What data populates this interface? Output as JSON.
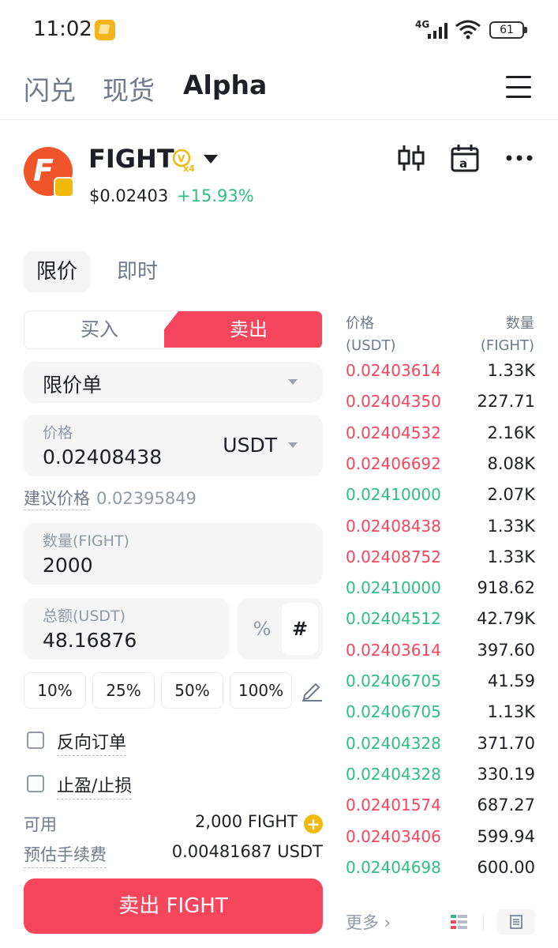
{
  "status_bar": {
    "time": "11:02",
    "network": "4G",
    "battery": "61"
  },
  "nav": {
    "tabs": [
      "闪兑",
      "现货",
      "Alpha"
    ],
    "active": "Alpha"
  },
  "token": {
    "name": "FIGHT",
    "badge": "x4",
    "price": "$0.02403",
    "change": "+15.93%",
    "change_color": "#2ebd85"
  },
  "order_tabs": [
    "限价",
    "即时"
  ],
  "side": {
    "buy": "买入",
    "sell": "卖出",
    "sell_color": "#f6465d"
  },
  "form": {
    "order_type": "限价单",
    "price_label": "价格",
    "price_value": "0.02408438",
    "price_unit": "USDT",
    "suggest_label": "建议价格",
    "suggest_value": "0.02395849",
    "qty_label": "数量(FIGHT)",
    "qty_value": "2000",
    "total_label": "总额(USDT)",
    "total_value": "48.16876",
    "mode_pct": "%",
    "mode_hash": "#",
    "pct_buttons": [
      "10%",
      "25%",
      "50%",
      "100%"
    ],
    "reverse_order": "反向订单",
    "tp_sl": "止盈/止损",
    "available_label": "可用",
    "available_value": "2,000 FIGHT",
    "fee_label": "预估手续费",
    "fee_value": "0.00481687 USDT",
    "submit": "卖出 FIGHT"
  },
  "orderbook": {
    "price_header": "价格",
    "price_unit": "(USDT)",
    "qty_header": "数量",
    "qty_unit": "(FIGHT)",
    "rows": [
      {
        "price": "0.02403614",
        "qty": "1.33K",
        "side": "red"
      },
      {
        "price": "0.02404350",
        "qty": "227.71",
        "side": "red"
      },
      {
        "price": "0.02404532",
        "qty": "2.16K",
        "side": "red"
      },
      {
        "price": "0.02406692",
        "qty": "8.08K",
        "side": "red"
      },
      {
        "price": "0.02410000",
        "qty": "2.07K",
        "side": "green"
      },
      {
        "price": "0.02408438",
        "qty": "1.33K",
        "side": "red"
      },
      {
        "price": "0.02408752",
        "qty": "1.33K",
        "side": "red"
      },
      {
        "price": "0.02410000",
        "qty": "918.62",
        "side": "green"
      },
      {
        "price": "0.02404512",
        "qty": "42.79K",
        "side": "green"
      },
      {
        "price": "0.02403614",
        "qty": "397.60",
        "side": "red"
      },
      {
        "price": "0.02406705",
        "qty": "41.59",
        "side": "green"
      },
      {
        "price": "0.02406705",
        "qty": "1.13K",
        "side": "green"
      },
      {
        "price": "0.02404328",
        "qty": "371.70",
        "side": "green"
      },
      {
        "price": "0.02404328",
        "qty": "330.19",
        "side": "green"
      },
      {
        "price": "0.02401574",
        "qty": "687.27",
        "side": "red"
      },
      {
        "price": "0.02403406",
        "qty": "599.94",
        "side": "red"
      },
      {
        "price": "0.02404698",
        "qty": "600.00",
        "side": "green"
      }
    ],
    "more": "更多 ›"
  }
}
